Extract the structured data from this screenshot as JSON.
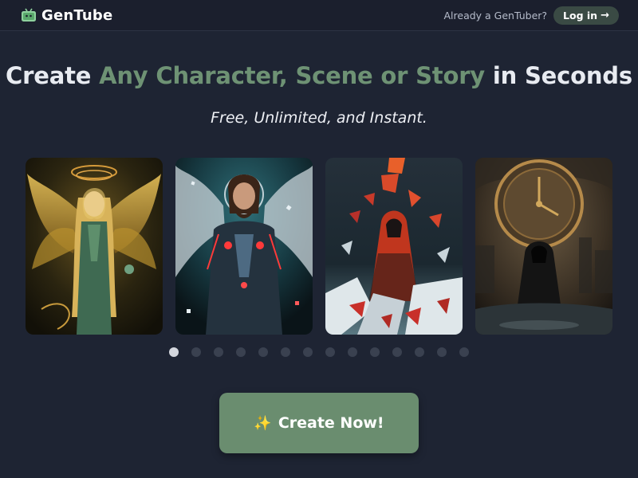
{
  "header": {
    "brand": "GenTube",
    "already_text": "Already a GenTuber?",
    "login_label": "Log in",
    "login_arrow": "→"
  },
  "hero": {
    "headline_start": "Create",
    "headline_accent": "Any Character, Scene or Story",
    "headline_end": "in Seconds",
    "subheadline": "Free, Unlimited, and Instant."
  },
  "carousel": {
    "cards": [
      {
        "subject": "golden angel woman with halo"
      },
      {
        "subject": "bearded warrior with wings and glowing armor"
      },
      {
        "subject": "hooded figure in shattered red shards"
      },
      {
        "subject": "cloaked figure beneath giant clock"
      }
    ],
    "dot_count": 14,
    "active_index": 0
  },
  "cta": {
    "icon": "sparkles-icon",
    "label": "Create Now!"
  },
  "colors": {
    "background": "#1e2433",
    "accent": "#6e9274",
    "cta": "#6a8d6f"
  }
}
